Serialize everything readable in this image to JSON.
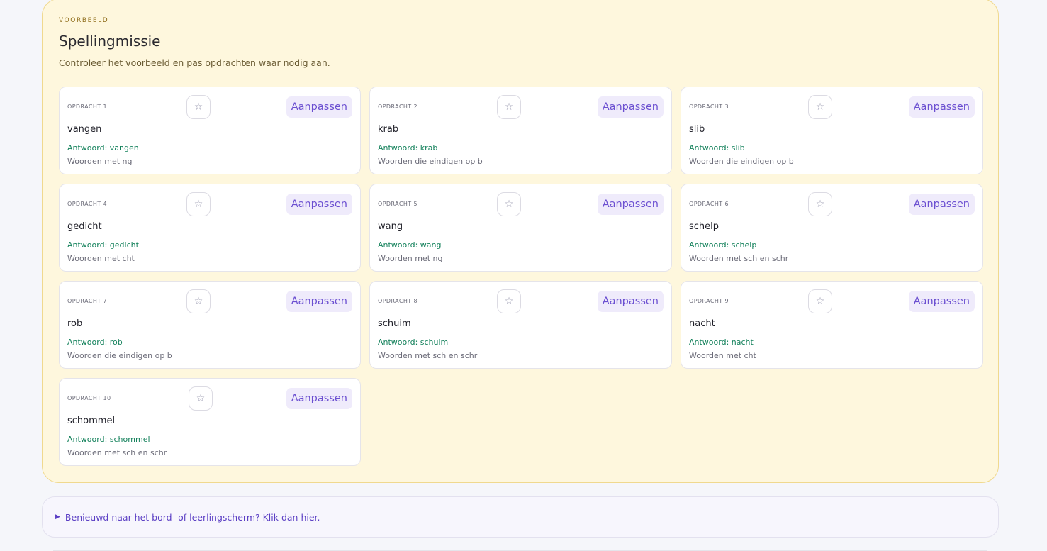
{
  "preview": {
    "eyebrow": "VOORBEELD",
    "title": "Spellingmissie",
    "subtitle": "Controleer het voorbeeld en pas opdrachten waar nodig aan.",
    "edit_label": "Aanpassen",
    "star_icon": "star-icon",
    "tasks": [
      {
        "number": "OPDRACHT 1",
        "word": "vangen",
        "answer": "Antwoord: vangen",
        "category": "Woorden met ng"
      },
      {
        "number": "OPDRACHT 2",
        "word": "krab",
        "answer": "Antwoord: krab",
        "category": "Woorden die eindigen op b"
      },
      {
        "number": "OPDRACHT 3",
        "word": "slib",
        "answer": "Antwoord: slib",
        "category": "Woorden die eindigen op b"
      },
      {
        "number": "OPDRACHT 4",
        "word": "gedicht",
        "answer": "Antwoord: gedicht",
        "category": "Woorden met cht"
      },
      {
        "number": "OPDRACHT 5",
        "word": "wang",
        "answer": "Antwoord: wang",
        "category": "Woorden met ng"
      },
      {
        "number": "OPDRACHT 6",
        "word": "schelp",
        "answer": "Antwoord: schelp",
        "category": "Woorden met sch en schr"
      },
      {
        "number": "OPDRACHT 7",
        "word": "rob",
        "answer": "Antwoord: rob",
        "category": "Woorden die eindigen op b"
      },
      {
        "number": "OPDRACHT 8",
        "word": "schuim",
        "answer": "Antwoord: schuim",
        "category": "Woorden met sch en schr"
      },
      {
        "number": "OPDRACHT 9",
        "word": "nacht",
        "answer": "Antwoord: nacht",
        "category": "Woorden met cht"
      },
      {
        "number": "OPDRACHT 10",
        "word": "schommel",
        "answer": "Antwoord: schommel",
        "category": "Woorden met sch en schr"
      }
    ]
  },
  "details_toggle": {
    "caret": "▶",
    "label": "Benieuwd naar het bord- of leerlingscherm? Klik dan hier."
  },
  "colors": {
    "panel_background": "#fef7dd",
    "accent": "#6b4fd1",
    "answer_green": "#12805a"
  }
}
